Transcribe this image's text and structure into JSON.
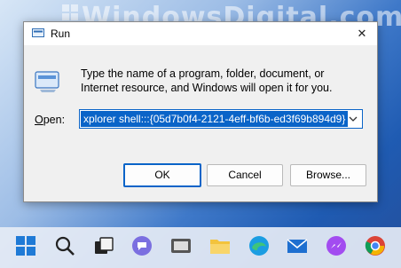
{
  "watermark": {
    "text": "WindowsDigital.com"
  },
  "dialog": {
    "title": "Run",
    "description": "Type the name of a program, folder, document, or Internet resource, and Windows will open it for you.",
    "open_label_prefix": "O",
    "open_label_rest": "pen:",
    "input_value": "xplorer shell:::{05d7b0f4-2121-4eff-bf6b-ed3f69b894d9}",
    "buttons": {
      "ok": "OK",
      "cancel": "Cancel",
      "browse": "Browse..."
    }
  },
  "taskbar": {
    "icons": [
      "windows-start-icon",
      "search-icon",
      "task-view-icon",
      "teams-chat-icon",
      "screen-capture-icon",
      "file-explorer-icon",
      "edge-browser-icon",
      "mail-icon",
      "messenger-icon",
      "chrome-icon"
    ]
  },
  "colors": {
    "accent": "#0a64c8",
    "dialog_bg": "#f0f0f0",
    "taskbar_bg": "#e6ecf5"
  }
}
